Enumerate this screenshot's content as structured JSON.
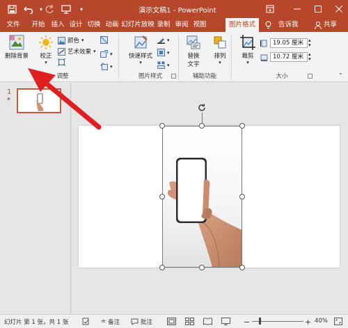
{
  "titlebar": {
    "title": "演示文稿1 - PowerPoint",
    "background": "#b7472a",
    "icons": [
      "save-icon",
      "undo-icon",
      "redo-icon",
      "present-icon",
      "qat-dropdown-icon"
    ]
  },
  "tabs": [
    {
      "label": "文件",
      "active": false
    },
    {
      "label": "开始",
      "active": false
    },
    {
      "label": "插入",
      "active": false
    },
    {
      "label": "设计",
      "active": false
    },
    {
      "label": "切换",
      "active": false
    },
    {
      "label": "动画",
      "active": false
    },
    {
      "label": "幻灯片放映",
      "active": false
    },
    {
      "label": "录制",
      "active": false
    },
    {
      "label": "审阅",
      "active": false
    },
    {
      "label": "视图",
      "active": false
    },
    {
      "label": "图片格式",
      "active": true
    }
  ],
  "tab_right": {
    "tell_me": "告诉我",
    "share": "共享"
  },
  "ribbon": {
    "remove_background": "删除背景",
    "corrections": "校正",
    "color": "颜色",
    "artistic_effects": "艺术效果",
    "adjust_group": "调整",
    "quick_styles": "快速样式",
    "picture_styles_group": "图片样式",
    "alt_text_line1": "替换",
    "alt_text_line2": "文字",
    "accessibility_group": "辅助功能",
    "arrange": "排列",
    "crop": "裁剪",
    "height": "19.05 厘米",
    "width": "10.72 厘米",
    "size_group": "大小"
  },
  "thumbnails": {
    "slide_number": "1",
    "star": "*"
  },
  "statusbar": {
    "slide_info": "幻灯片 第 1 张，共 1 张",
    "notes": "备注",
    "comments": "批注",
    "zoom": "40%"
  },
  "colors": {
    "accent": "#b7472a",
    "annotation_arrow": "#e02020",
    "selection_handle": "#ffffff"
  }
}
